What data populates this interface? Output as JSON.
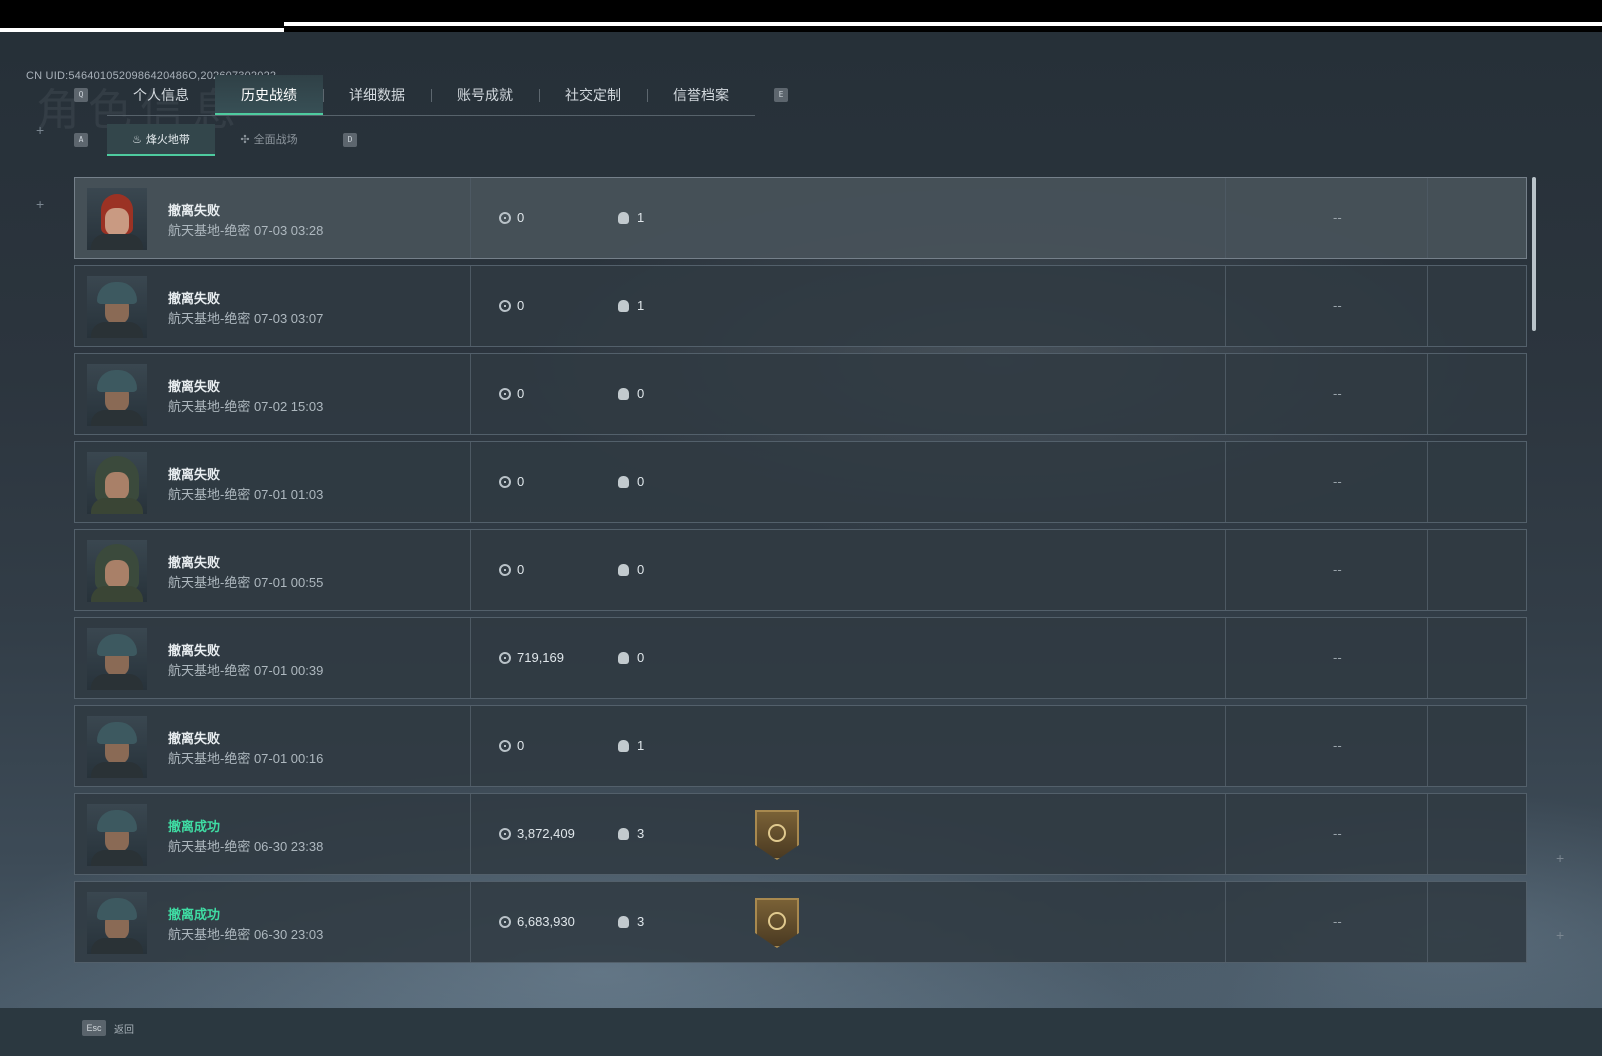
{
  "header": {
    "uid_text": "CN UID:5464010520986420486O,202607302022",
    "ghost_title": "角色信息",
    "tab_prev_key": "Q",
    "tab_next_key": "E",
    "subtab_prev_key": "A",
    "subtab_next_key": "D"
  },
  "tabs": [
    {
      "label": "个人信息"
    },
    {
      "label": "历史战绩"
    },
    {
      "label": "详细数据"
    },
    {
      "label": "账号成就"
    },
    {
      "label": "社交定制"
    },
    {
      "label": "信誉档案"
    }
  ],
  "active_tab": "历史战绩",
  "subtabs": [
    {
      "label": "烽火地带",
      "icon": "flame-icon",
      "glyph": "♨"
    },
    {
      "label": "全面战场",
      "icon": "crosshair-icon",
      "glyph": "✣"
    }
  ],
  "active_subtab": "烽火地带",
  "records": [
    {
      "status": "撤离失败",
      "success": false,
      "avatar": "female-red-hair",
      "map_info": "航天基地-绝密 07-03 03:28",
      "value": "0",
      "kills": "1",
      "badge": false,
      "extra": "--"
    },
    {
      "status": "撤离失败",
      "success": false,
      "avatar": "male-helmet",
      "map_info": "航天基地-绝密 07-03 03:07",
      "value": "0",
      "kills": "1",
      "badge": false,
      "extra": "--"
    },
    {
      "status": "撤离失败",
      "success": false,
      "avatar": "male-helmet",
      "map_info": "航天基地-绝密 07-02 15:03",
      "value": "0",
      "kills": "0",
      "badge": false,
      "extra": "--"
    },
    {
      "status": "撤离失败",
      "success": false,
      "avatar": "female-hood",
      "map_info": "航天基地-绝密 07-01 01:03",
      "value": "0",
      "kills": "0",
      "badge": false,
      "extra": "--"
    },
    {
      "status": "撤离失败",
      "success": false,
      "avatar": "female-hood",
      "map_info": "航天基地-绝密 07-01 00:55",
      "value": "0",
      "kills": "0",
      "badge": false,
      "extra": "--"
    },
    {
      "status": "撤离失败",
      "success": false,
      "avatar": "male-helmet",
      "map_info": "航天基地-绝密 07-01 00:39",
      "value": "719,169",
      "kills": "0",
      "badge": false,
      "extra": "--"
    },
    {
      "status": "撤离失败",
      "success": false,
      "avatar": "male-helmet",
      "map_info": "航天基地-绝密 07-01 00:16",
      "value": "0",
      "kills": "1",
      "badge": false,
      "extra": "--"
    },
    {
      "status": "撤离成功",
      "success": true,
      "avatar": "male-helmet",
      "map_info": "航天基地-绝密 06-30 23:38",
      "value": "3,872,409",
      "kills": "3",
      "badge": true,
      "extra": "--"
    },
    {
      "status": "撤离成功",
      "success": true,
      "avatar": "male-helmet",
      "map_info": "航天基地-绝密 06-30 23:03",
      "value": "6,683,930",
      "kills": "3",
      "badge": true,
      "extra": "--"
    }
  ],
  "footer": {
    "esc_key": "Esc",
    "esc_label": "返回"
  },
  "colors": {
    "accent_green": "#4ecb9f",
    "success_text": "#3fdca3"
  }
}
